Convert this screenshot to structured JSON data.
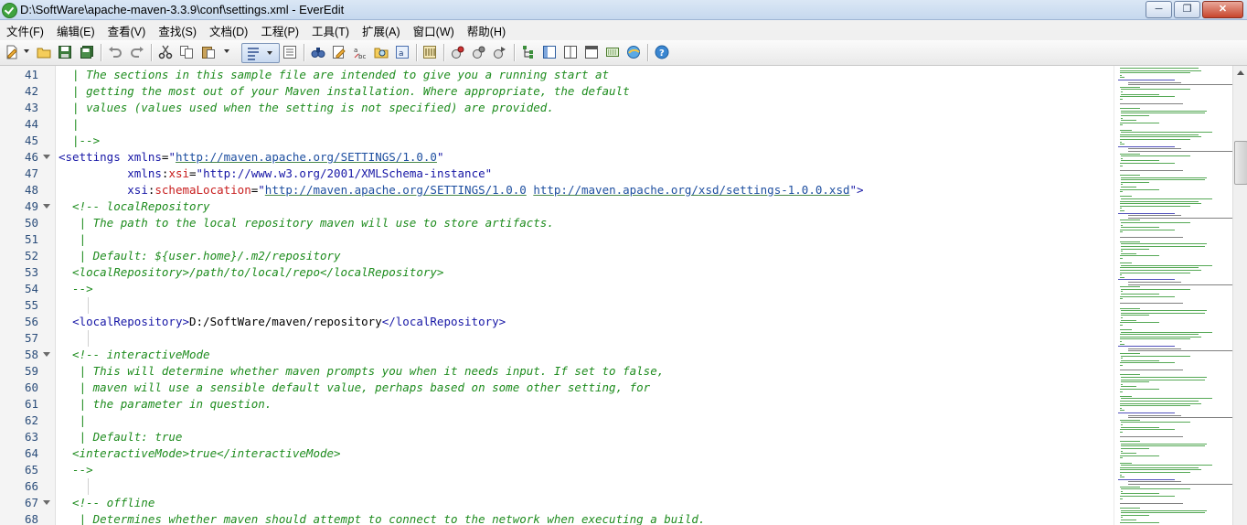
{
  "window": {
    "title": "D:\\SoftWare\\apache-maven-3.3.9\\conf\\settings.xml - EverEdit",
    "minimize_label": "─",
    "maximize_label": "❐",
    "close_label": "✕"
  },
  "menu": [
    {
      "id": "file",
      "label": "文件(F)"
    },
    {
      "id": "edit",
      "label": "编辑(E)"
    },
    {
      "id": "view",
      "label": "查看(V)"
    },
    {
      "id": "find",
      "label": "查找(S)"
    },
    {
      "id": "document",
      "label": "文档(D)"
    },
    {
      "id": "project",
      "label": "工程(P)"
    },
    {
      "id": "tools",
      "label": "工具(T)"
    },
    {
      "id": "extend",
      "label": "扩展(A)"
    },
    {
      "id": "window",
      "label": "窗口(W)"
    },
    {
      "id": "help",
      "label": "帮助(H)"
    }
  ],
  "editor": {
    "lines": [
      {
        "n": "41",
        "fold": false,
        "guide": false,
        "segs": [
          [
            "com",
            "  | The sections in this sample file are intended to give you a running start at"
          ]
        ]
      },
      {
        "n": "42",
        "fold": false,
        "guide": false,
        "segs": [
          [
            "com",
            "  | getting the most out of your Maven installation. Where appropriate, the default"
          ]
        ]
      },
      {
        "n": "43",
        "fold": false,
        "guide": false,
        "segs": [
          [
            "com",
            "  | values (values used when the setting is not specified) are provided."
          ]
        ]
      },
      {
        "n": "44",
        "fold": false,
        "guide": false,
        "segs": [
          [
            "com",
            "  |"
          ]
        ]
      },
      {
        "n": "45",
        "fold": false,
        "guide": false,
        "segs": [
          [
            "com",
            "  |-->"
          ]
        ]
      },
      {
        "n": "46",
        "fold": true,
        "guide": false,
        "segs": [
          [
            "tag",
            "<settings "
          ],
          [
            "attr",
            "xmlns"
          ],
          [
            "txt",
            "="
          ],
          [
            "val",
            "\""
          ],
          [
            "url",
            "http://maven.apache.org/SETTINGS/1.0.0"
          ],
          [
            "val",
            "\""
          ]
        ]
      },
      {
        "n": "47",
        "fold": false,
        "guide": false,
        "segs": [
          [
            "txt",
            "          "
          ],
          [
            "attr",
            "xmlns"
          ],
          [
            "txt",
            ":"
          ],
          [
            "ns",
            "xsi"
          ],
          [
            "txt",
            "="
          ],
          [
            "val",
            "\"http://www.w3.org/2001/XMLSchema-instance\""
          ]
        ]
      },
      {
        "n": "48",
        "fold": false,
        "guide": false,
        "segs": [
          [
            "txt",
            "          "
          ],
          [
            "attr",
            "xsi"
          ],
          [
            "txt",
            ":"
          ],
          [
            "ns",
            "schemaLocation"
          ],
          [
            "txt",
            "="
          ],
          [
            "val",
            "\""
          ],
          [
            "url",
            "http://maven.apache.org/SETTINGS/1.0.0"
          ],
          [
            "txt",
            " "
          ],
          [
            "url",
            "http://maven.apache.org/xsd/settings-1.0.0.xsd"
          ],
          [
            "val",
            "\">"
          ]
        ]
      },
      {
        "n": "49",
        "fold": true,
        "guide": false,
        "segs": [
          [
            "com",
            "  <!-- localRepository"
          ]
        ]
      },
      {
        "n": "50",
        "fold": false,
        "guide": false,
        "segs": [
          [
            "com",
            "   | The path to the local repository maven will use to store artifacts."
          ]
        ]
      },
      {
        "n": "51",
        "fold": false,
        "guide": false,
        "segs": [
          [
            "com",
            "   |"
          ]
        ]
      },
      {
        "n": "52",
        "fold": false,
        "guide": false,
        "segs": [
          [
            "com",
            "   | Default: ${user.home}/.m2/repository"
          ]
        ]
      },
      {
        "n": "53",
        "fold": false,
        "guide": false,
        "segs": [
          [
            "com",
            "  <localRepository>/path/to/local/repo</localRepository>"
          ]
        ]
      },
      {
        "n": "54",
        "fold": false,
        "guide": false,
        "segs": [
          [
            "com",
            "  -->"
          ]
        ]
      },
      {
        "n": "55",
        "fold": false,
        "guide": true,
        "segs": [
          [
            "txt",
            ""
          ]
        ]
      },
      {
        "n": "56",
        "fold": false,
        "guide": false,
        "segs": [
          [
            "txt",
            "  "
          ],
          [
            "tag",
            "<localRepository>"
          ],
          [
            "txt",
            "D:/SoftWare/maven/repository"
          ],
          [
            "tag",
            "</localRepository>"
          ]
        ]
      },
      {
        "n": "57",
        "fold": false,
        "guide": true,
        "segs": [
          [
            "txt",
            ""
          ]
        ]
      },
      {
        "n": "58",
        "fold": true,
        "guide": false,
        "segs": [
          [
            "com",
            "  <!-- interactiveMode"
          ]
        ]
      },
      {
        "n": "59",
        "fold": false,
        "guide": false,
        "segs": [
          [
            "com",
            "   | This will determine whether maven prompts you when it needs input. If set to false,"
          ]
        ]
      },
      {
        "n": "60",
        "fold": false,
        "guide": false,
        "segs": [
          [
            "com",
            "   | maven will use a sensible default value, perhaps based on some other setting, for"
          ]
        ]
      },
      {
        "n": "61",
        "fold": false,
        "guide": false,
        "segs": [
          [
            "com",
            "   | the parameter in question."
          ]
        ]
      },
      {
        "n": "62",
        "fold": false,
        "guide": false,
        "segs": [
          [
            "com",
            "   |"
          ]
        ]
      },
      {
        "n": "63",
        "fold": false,
        "guide": false,
        "segs": [
          [
            "com",
            "   | Default: true"
          ]
        ]
      },
      {
        "n": "64",
        "fold": false,
        "guide": false,
        "segs": [
          [
            "com",
            "  <interactiveMode>true</interactiveMode>"
          ]
        ]
      },
      {
        "n": "65",
        "fold": false,
        "guide": false,
        "segs": [
          [
            "com",
            "  -->"
          ]
        ]
      },
      {
        "n": "66",
        "fold": false,
        "guide": true,
        "segs": [
          [
            "txt",
            ""
          ]
        ]
      },
      {
        "n": "67",
        "fold": true,
        "guide": false,
        "segs": [
          [
            "com",
            "  <!-- offline"
          ]
        ]
      },
      {
        "n": "68",
        "fold": false,
        "guide": false,
        "segs": [
          [
            "com",
            "   | Determines whether maven should attempt to connect to the network when executing a build."
          ]
        ]
      }
    ]
  },
  "colors": {
    "comment": "#1e8c1e",
    "tag": "#1717a6",
    "namespace": "#c81e1e",
    "line_number": "#2b4d7a"
  }
}
